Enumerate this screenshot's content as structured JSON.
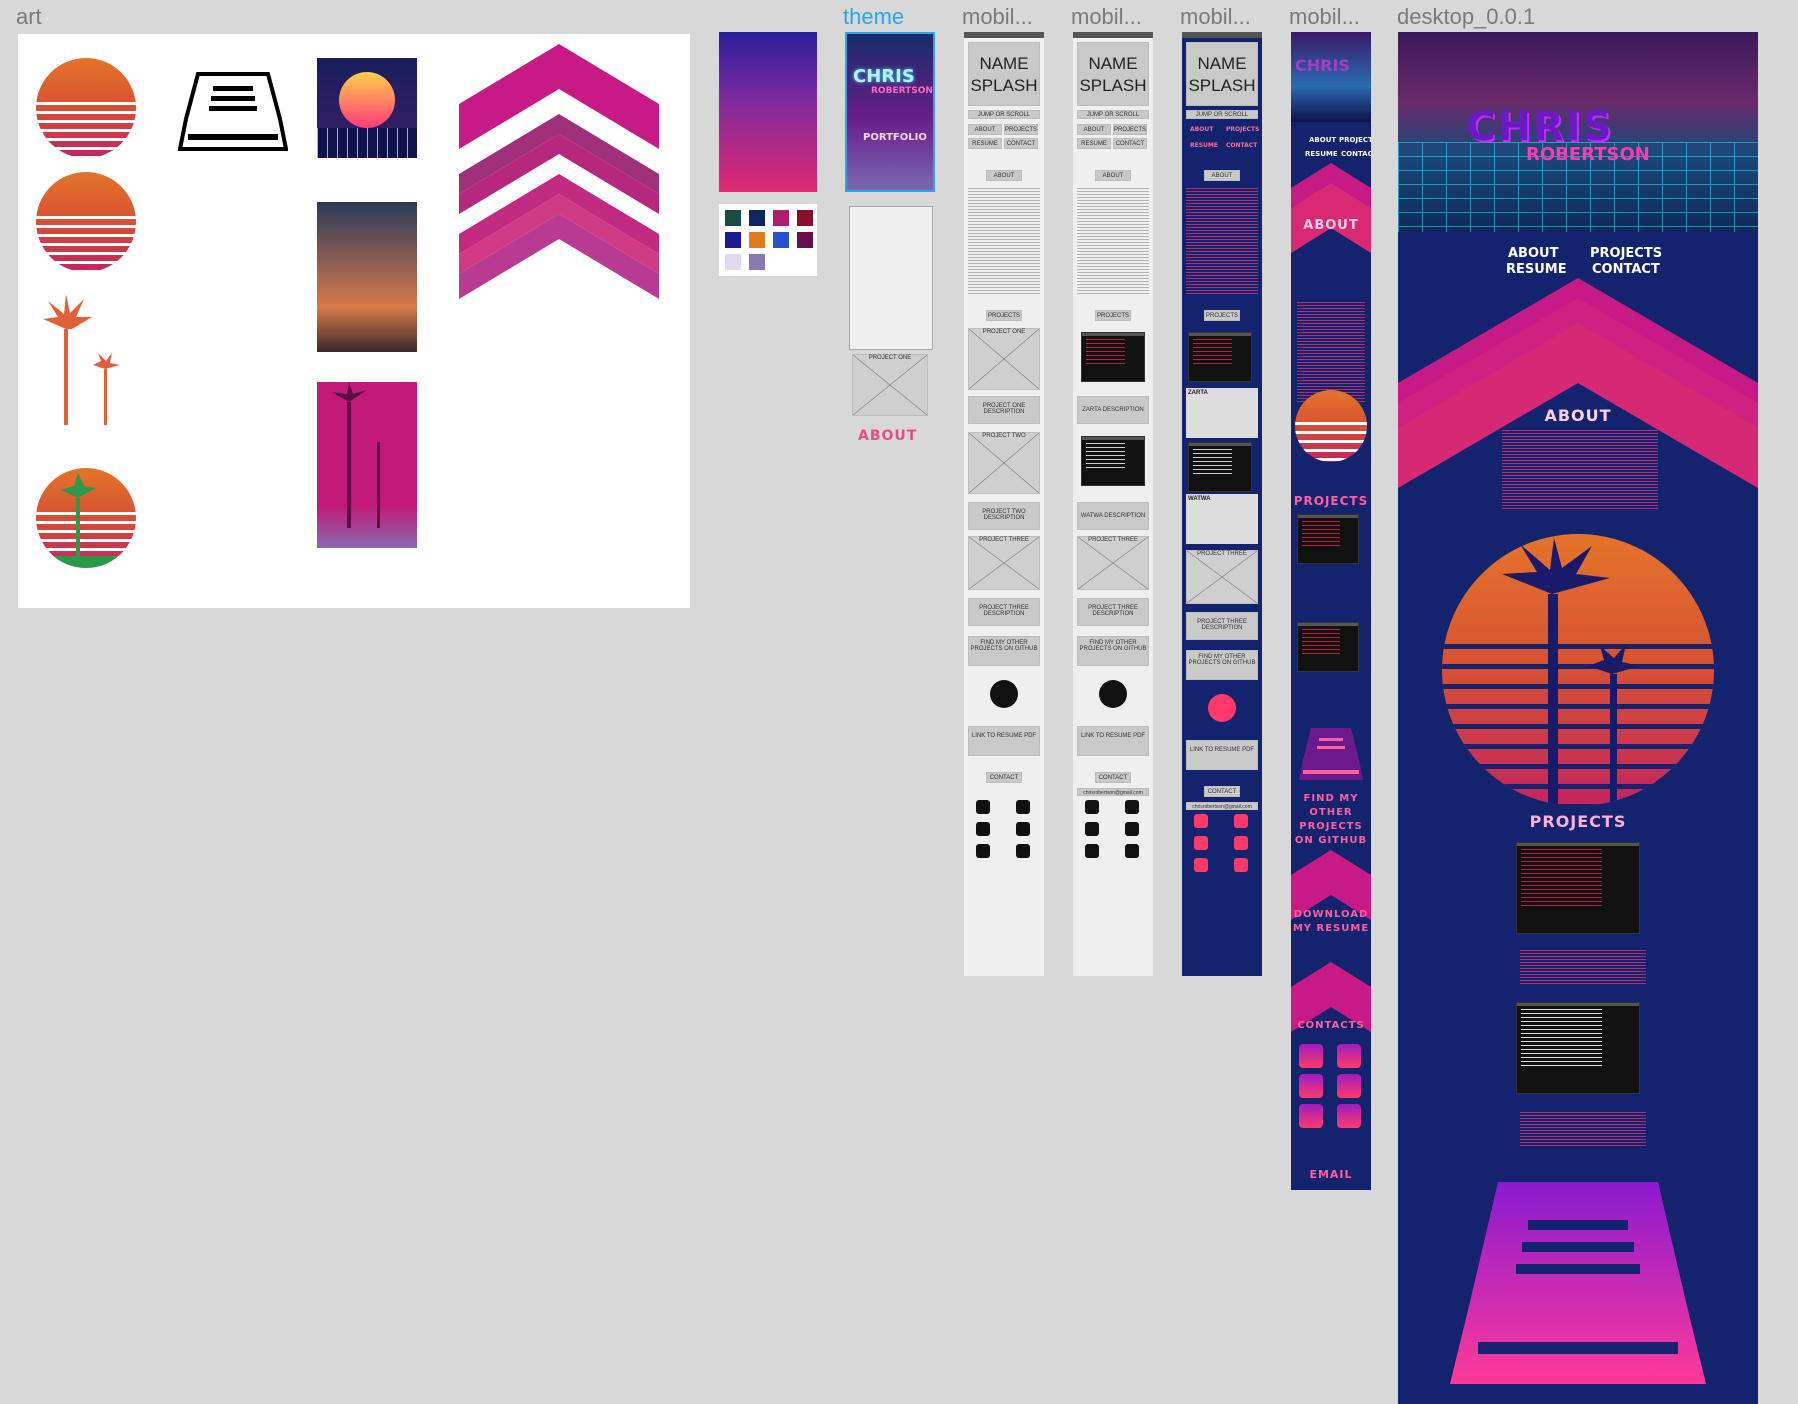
{
  "frames": {
    "art": "art",
    "theme": "theme",
    "mobile1": "mobil...",
    "mobile2": "mobil...",
    "mobile3": "mobil...",
    "mobile4": "mobil...",
    "desktop": "desktop_0.0.1"
  },
  "colors": {
    "canvas": "#d8d8d8",
    "navy": "#13236d",
    "magenta": "#c81a86",
    "pink": "#ff5ea0",
    "orange": "#e4742a"
  },
  "swatches": [
    "#1a4a45",
    "#0f2760",
    "#b01e6a",
    "#8a0d2a",
    "#1d1a9a",
    "#e07a1f",
    "#2a4fd0",
    "#6a0f4a",
    "#e2d8ef",
    "#8a78b0"
  ],
  "theme": {
    "logo_line1": "CHRIS",
    "logo_line2": "ROBERTSON",
    "portfolio": "PORTFOLIO",
    "project_one": "PROJECT ONE",
    "about": "ABOUT"
  },
  "wireframe": {
    "name_splash_1": "NAME",
    "name_splash_2": "SPLASH",
    "jump": "JUMP OR SCROLL",
    "nav": [
      "ABOUT",
      "PROJECTS",
      "RESUME",
      "CONTACT"
    ],
    "about": "ABOUT",
    "projects": "PROJECTS",
    "project_one": "PROJECT ONE",
    "project_one_desc": "PROJECT ONE DESCRIPTION",
    "project_two": "PROJECT TWO",
    "project_two_desc": "PROJECT TWO DESCRIPTION",
    "project_three": "PROJECT THREE",
    "project_three_desc": "PROJECT THREE DESCRIPTION",
    "zarta_desc": "ZARTA DESCRIPTION",
    "watwa_desc": "WATWA DESCRIPTION",
    "github": "FIND MY OTHER PROJECTS ON GITHUB",
    "resume": "LINK TO RESUME PDF",
    "contact": "CONTACT",
    "email": "chrisrobertson@gmail.com",
    "zarta": "ZARTA",
    "watwa": "WATWA"
  },
  "mobile4": {
    "about": "ABOUT",
    "projects": "PROJECTS",
    "github": "FIND MY OTHER PROJECTS ON GITHUB",
    "download": "DOWNLOAD MY RESUME",
    "contacts": "CONTACTS",
    "email": "EMAIL"
  },
  "desktop": {
    "logo_line1": "CHRIS",
    "logo_line2": "ROBERTSON",
    "nav": [
      "ABOUT",
      "PROJECTS",
      "RESUME",
      "CONTACT"
    ],
    "about": "ABOUT",
    "projects": "PROJECTS"
  },
  "icons": [
    "github-icon",
    "linkedin-icon",
    "twitter-icon",
    "wordpress-icon",
    "codepen-icon",
    "instagram-icon"
  ]
}
